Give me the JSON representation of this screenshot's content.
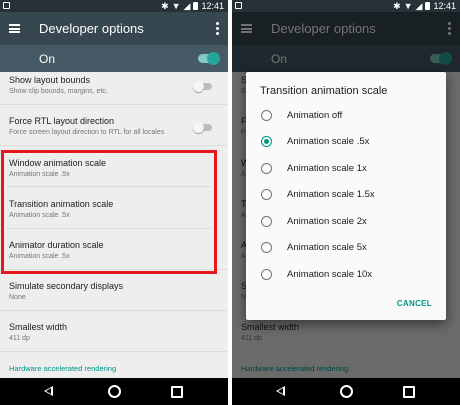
{
  "status_bar": {
    "time": "12:41"
  },
  "toolbar": {
    "title": "Developer options"
  },
  "master_switch": {
    "label": "On",
    "state": "on"
  },
  "settings": [
    {
      "title": "Show layout bounds",
      "summary": "Show clip bounds, margins, etc.",
      "toggle": "off"
    },
    {
      "title": "Force RTL layout direction",
      "summary": "Force screen layout direction to RTL for all locales",
      "toggle": "off"
    },
    {
      "title": "Window animation scale",
      "summary": "Animation scale .5x"
    },
    {
      "title": "Transition animation scale",
      "summary": "Animation scale .5x"
    },
    {
      "title": "Animator duration scale",
      "summary": "Animation scale .5x"
    },
    {
      "title": "Simulate secondary displays",
      "summary": "None"
    },
    {
      "title": "Smallest width",
      "summary": "411 dp"
    }
  ],
  "section_header": "Hardware accelerated rendering",
  "dialog": {
    "title": "Transition animation scale",
    "options": [
      "Animation off",
      "Animation scale .5x",
      "Animation scale 1x",
      "Animation scale 1.5x",
      "Animation scale 2x",
      "Animation scale 5x",
      "Animation scale 10x"
    ],
    "selected_index": 1,
    "cancel_label": "CANCEL"
  },
  "colors": {
    "accent": "#009688",
    "toolbar": "#37474f",
    "master_bar": "#455a64",
    "highlight_box": "#e3171d"
  },
  "icons": {
    "status_left": "image-icon",
    "status_right": [
      "bluetooth-icon",
      "wifi-icon",
      "signal-icon",
      "battery-icon"
    ],
    "toolbar_left": "menu-icon",
    "toolbar_right": "more-vert-icon",
    "nav": [
      "back-icon",
      "home-icon",
      "recents-icon"
    ]
  }
}
